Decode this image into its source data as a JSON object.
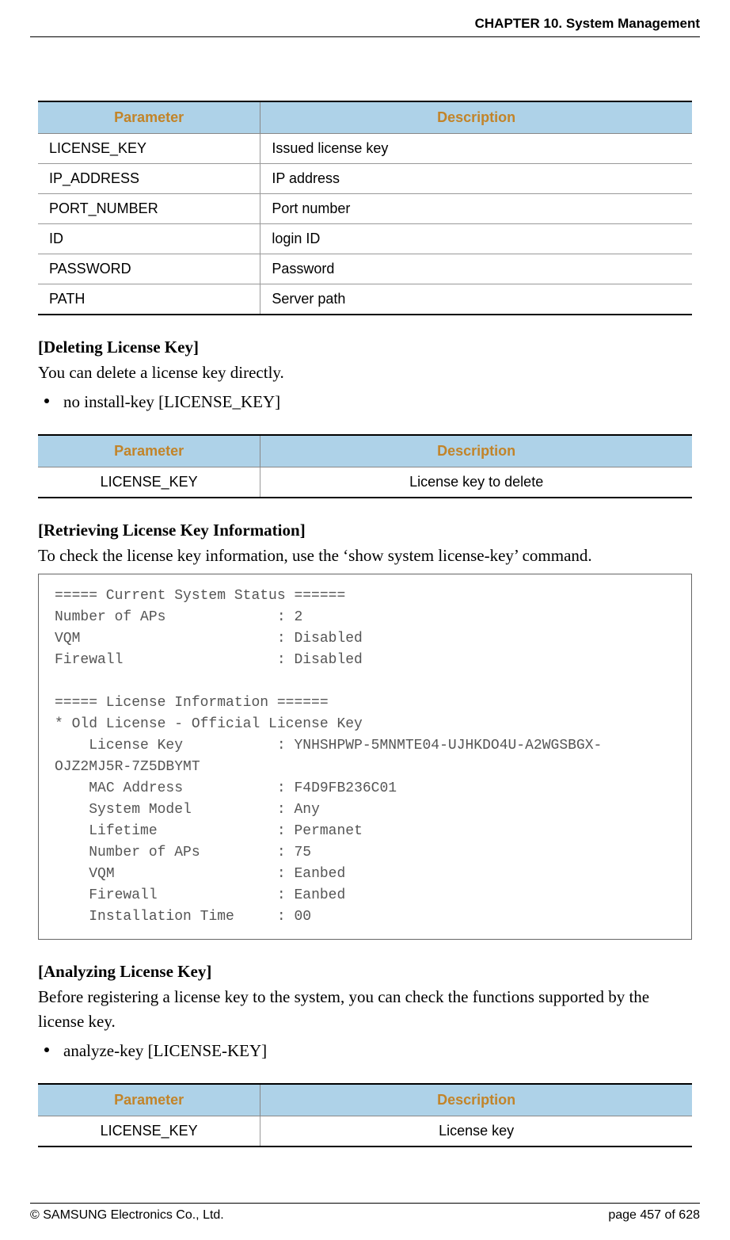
{
  "header": {
    "chapter": "CHAPTER 10. System Management"
  },
  "table1": {
    "headers": [
      "Parameter",
      "Description"
    ],
    "rows": [
      {
        "param": "LICENSE_KEY",
        "desc": "Issued license key"
      },
      {
        "param": "IP_ADDRESS",
        "desc": "IP address"
      },
      {
        "param": "PORT_NUMBER",
        "desc": "Port number"
      },
      {
        "param": "ID",
        "desc": "login ID"
      },
      {
        "param": "PASSWORD",
        "desc": "Password"
      },
      {
        "param": "PATH",
        "desc": "Server path"
      }
    ]
  },
  "section_delete": {
    "heading": "[Deleting License Key]",
    "text": "You can delete a license key directly.",
    "bullet": "no install-key [LICENSE_KEY]"
  },
  "table2": {
    "headers": [
      "Parameter",
      "Description"
    ],
    "rows": [
      {
        "param": "LICENSE_KEY",
        "desc": "License key to delete"
      }
    ]
  },
  "section_retrieve": {
    "heading": "[Retrieving License Key Information]",
    "text": "To check the license key information, use the ‘show system license-key’ command."
  },
  "code_block": "===== Current System Status ======\nNumber of APs             : 2\nVQM                       : Disabled\nFirewall                  : Disabled\n\n===== License Information ======\n* Old License - Official License Key\n    License Key           : YNHSHPWP-5MNMTE04-UJHKDO4U-A2WGSBGX-OJZ2MJ5R-7Z5DBYMT\n    MAC Address           : F4D9FB236C01\n    System Model          : Any\n    Lifetime              : Permanet\n    Number of APs         : 75\n    VQM                   : Eanbed\n    Firewall              : Eanbed\n    Installation Time     : 00",
  "section_analyze": {
    "heading": "[Analyzing License Key]",
    "text": "Before registering a license key to the system, you can check the functions supported by the license key.",
    "bullet": "analyze-key [LICENSE-KEY]"
  },
  "table3": {
    "headers": [
      "Parameter",
      "Description"
    ],
    "rows": [
      {
        "param": "LICENSE_KEY",
        "desc": "License key"
      }
    ]
  },
  "footer": {
    "copyright": "© SAMSUNG Electronics Co., Ltd.",
    "page": "page 457 of 628"
  }
}
